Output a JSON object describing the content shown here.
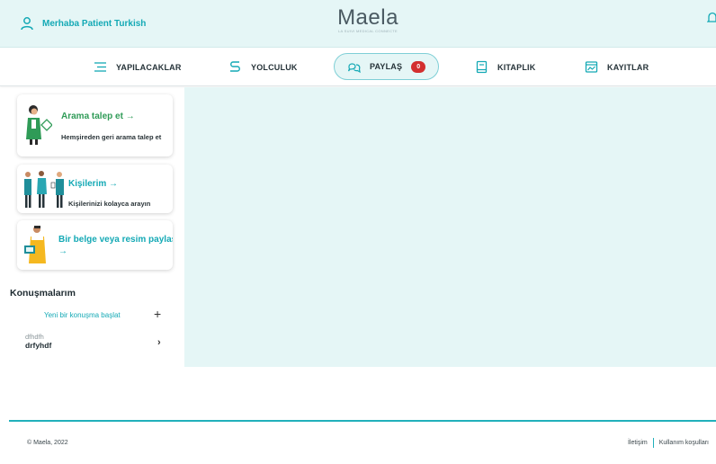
{
  "header": {
    "greeting": "Merhaba Patient Turkish",
    "logo": "Maela",
    "logo_tagline": "LA SUIVI MEDICAL CONNECTE",
    "icons": [
      "user-icon",
      "bell-icon"
    ]
  },
  "nav": {
    "items": [
      {
        "label": "YAPILACAKLAR",
        "icon": "list-icon"
      },
      {
        "label": "YOLCULUK",
        "icon": "route-icon"
      },
      {
        "label": "PAYLAŞ",
        "icon": "chat-icon",
        "badge": "0",
        "active": true
      },
      {
        "label": "KITAPLIK",
        "icon": "book-icon"
      },
      {
        "label": "KAYITLAR",
        "icon": "chart-icon"
      }
    ]
  },
  "sidebar": {
    "cards": [
      {
        "title": "Arama talep et →",
        "description": "Hemşireden geri arama talep et",
        "icon": "nurse-illustration"
      },
      {
        "title": "Kişilerim →",
        "description": "Kişilerinizi kolayca arayın",
        "icon": "doctors-illustration"
      },
      {
        "title": "Bir belge veya resim paylaş",
        "title_cont": "→",
        "icon": "person-document-illustration"
      }
    ],
    "conversations_title": "Konuşmalarım",
    "new_conversation": "Yeni bir konuşma başlat",
    "conversations": [
      {
        "subtitle": "dfhdfh",
        "name": "drfyhdf"
      }
    ]
  },
  "footer": {
    "copyright": "© Maela, 2022",
    "links": [
      "İletişim",
      "Kullanım koşulları"
    ]
  },
  "colors": {
    "accent": "#14a9b5",
    "header_bg": "#e5f6f6",
    "badge": "#d32f2f",
    "green": "#2f9b57"
  }
}
